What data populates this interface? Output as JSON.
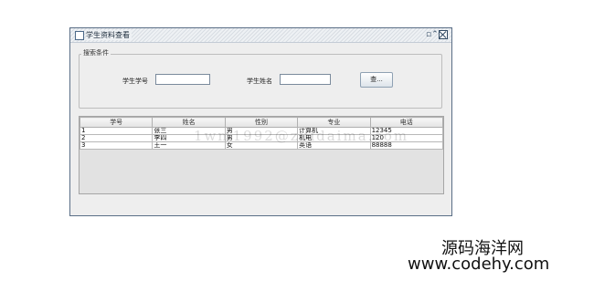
{
  "window": {
    "title": "学生资料查看",
    "minimize_glyph": "▫⌃",
    "close_icon": "close-icon"
  },
  "search": {
    "group_title": "搜索条件",
    "student_id_label": "学生学号",
    "student_id_value": "",
    "student_name_label": "学生姓名",
    "student_name_value": "",
    "query_button": "查..."
  },
  "table": {
    "columns": [
      "学号",
      "姓名",
      "性别",
      "专业",
      "电话"
    ],
    "rows": [
      [
        "1",
        "张三",
        "男",
        "计算机",
        "12345"
      ],
      [
        "2",
        "李四",
        "男",
        "机电",
        "120"
      ],
      [
        "3",
        "王一",
        "女",
        "英语",
        "88888"
      ]
    ]
  },
  "watermark": "1wm1992@zuidaima.com",
  "branding": {
    "name": "源码海洋网",
    "url": "www.codehy.com"
  }
}
